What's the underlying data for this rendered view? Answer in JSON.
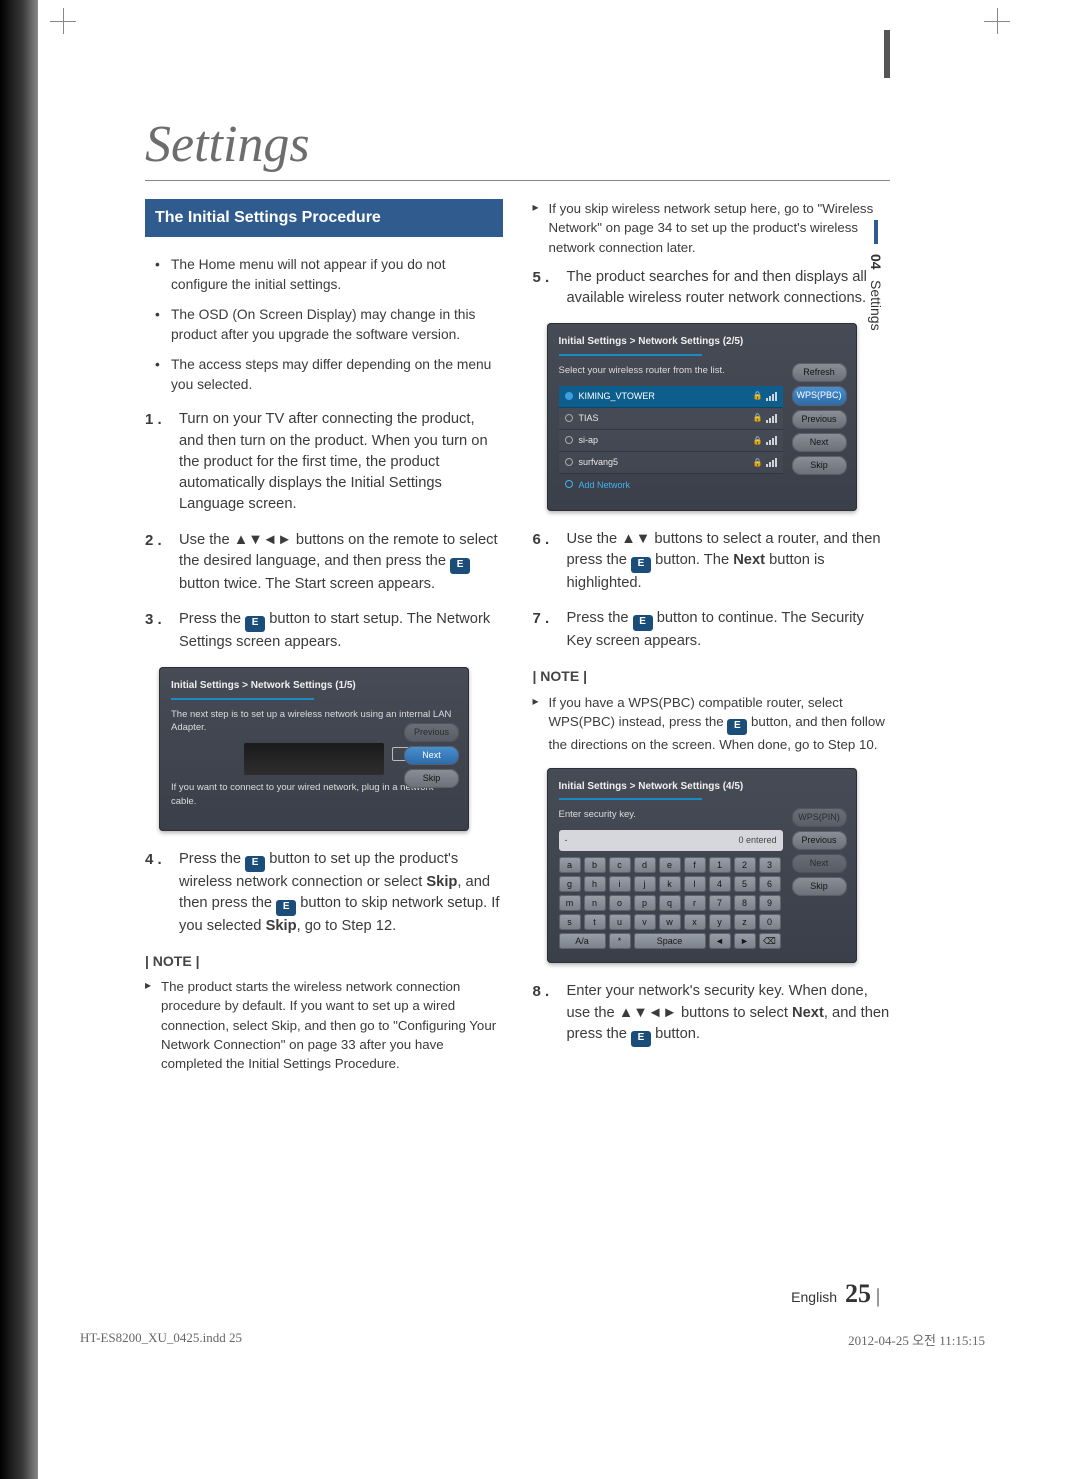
{
  "title": "Settings",
  "section_header": "The Initial Settings Procedure",
  "side_tab": {
    "chapter_num": "04",
    "chapter_name": "Settings"
  },
  "intro_bullets": [
    "The Home menu will not appear if you do not configure the initial settings.",
    "The OSD (On Screen Display) may change in this product after you upgrade the software version.",
    "The access steps may differ depending on the menu you selected."
  ],
  "steps": {
    "s1": "Turn on your TV after connecting the product, and then turn on the product. When you turn on the product for the first time, the product automatically displays the Initial Settings Language screen.",
    "s2_a": "Use the ▲▼◄► buttons on the remote to select the desired language, and then press the ",
    "s2_b": " button twice. The Start screen appears.",
    "s3_a": "Press the ",
    "s3_b": " button to start setup. The Network Settings screen appears.",
    "s4_a": "Press the ",
    "s4_b": " button to set up the product's wireless network connection or select ",
    "s4_skip": "Skip",
    "s4_c": ", and then press the ",
    "s4_d": " button to skip network setup. If you selected ",
    "s4_e": ", go to Step 12.",
    "s5": "The product searches for and then displays all available wireless router network connections.",
    "s6_a": "Use the ▲▼ buttons to select a router, and then press the ",
    "s6_b": " button. The ",
    "s6_next": "Next",
    "s6_c": " button is highlighted.",
    "s7_a": "Press the ",
    "s7_b": " button to continue. The Security Key screen appears.",
    "s8_a": "Enter your network's security key. When done, use the ▲▼◄► buttons to select ",
    "s8_next": "Next",
    "s8_b": ", and then press the ",
    "s8_c": " button."
  },
  "note_label": "| NOTE |",
  "notes_col1": [
    "The product starts the wireless network connection procedure by default. If you want to set up a wired connection, select Skip, and then go to \"Configuring Your Network Connection\" on page 33 after you have completed the Initial Settings Procedure."
  ],
  "notes_col2_top": [
    "If you skip wireless network setup here, go to \"Wireless Network\" on page 34 to set up the product's wireless network connection later."
  ],
  "notes_col2_mid": [
    "If you have a WPS(PBC) compatible router, select WPS(PBC) instead, press the  button, and then follow the directions on the screen. When done, go to Step 10."
  ],
  "notes_col2_mid_parts": {
    "a": "If you have a WPS(PBC) compatible router, select WPS(PBC) instead, press the ",
    "b": " button, and then follow the directions on the screen. When done, go to Step 10."
  },
  "osd1": {
    "crumb": "Initial Settings > Network Settings (1/5)",
    "msg1": "The next step is to set up a wireless network using an internal LAN Adapter.",
    "msg2": "If you want to connect to your wired network, plug in a network cable.",
    "buttons": [
      "Previous",
      "Next",
      "Skip"
    ]
  },
  "osd2": {
    "crumb": "Initial Settings > Network Settings (2/5)",
    "msg": "Select your wireless router from the list.",
    "routers": [
      "KIMING_VTOWER",
      "TIAS",
      "si-ap",
      "surfvang5"
    ],
    "add": "Add Network",
    "buttons": [
      "Refresh",
      "WPS(PBC)",
      "Previous",
      "Next",
      "Skip"
    ]
  },
  "osd3": {
    "crumb": "Initial Settings > Network Settings (4/5)",
    "msg": "Enter security key.",
    "entered": "0 entered",
    "buttons": [
      "WPS(PIN)",
      "Previous",
      "Next",
      "Skip"
    ],
    "row1": [
      "a",
      "b",
      "c",
      "d",
      "e",
      "f",
      "1",
      "2",
      "3"
    ],
    "row2": [
      "g",
      "h",
      "i",
      "j",
      "k",
      "l",
      "4",
      "5",
      "6"
    ],
    "row3": [
      "m",
      "n",
      "o",
      "p",
      "q",
      "r",
      "7",
      "8",
      "9"
    ],
    "row4": [
      "s",
      "t",
      "u",
      "v",
      "w",
      "x",
      "y",
      "z",
      "0"
    ],
    "row5": [
      "A/a",
      "*",
      "Space",
      "◄",
      "►",
      "⌫"
    ]
  },
  "footer": {
    "lang": "English",
    "page": "25"
  },
  "filefoot": {
    "left": "HT-ES8200_XU_0425.indd   25",
    "right": "2012-04-25   오전 11:15:15"
  },
  "enter_glyph": "E"
}
